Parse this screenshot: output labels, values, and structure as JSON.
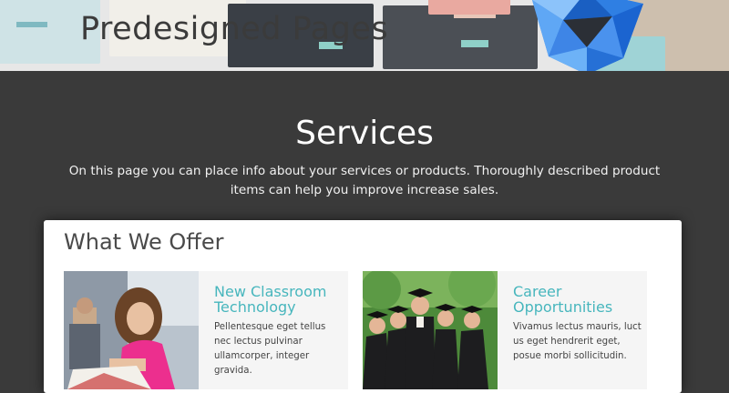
{
  "banner": {
    "title": "Predesigned Pages"
  },
  "services": {
    "title": "Services",
    "description": "On this page you can place info about your services or products. Thoroughly described product items can help you improve increase sales."
  },
  "offer_section": {
    "title": "What We Offer",
    "items": [
      {
        "heading": "New Classroom Technology",
        "body": "Pellentesque eget tellus nec lectus pulvinar ullamcorper, integer gravida.",
        "image": "student-reading-photo"
      },
      {
        "heading": "Career Opportunities",
        "body": "Vivamus lectus mauris, luct us eget hendrerit eget, posue morbi sollicitudin.",
        "image": "graduates-photo"
      }
    ]
  },
  "colors": {
    "page_background": "#3a3a3a",
    "accent_teal": "#47b6bd",
    "gem_blue": "#2f7fe3"
  }
}
